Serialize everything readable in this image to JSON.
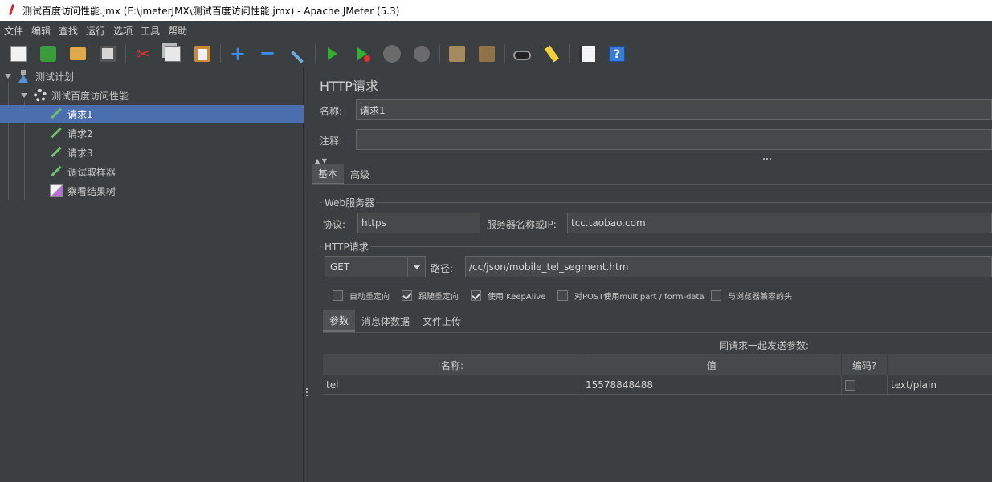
{
  "window": {
    "title": "测试百度访问性能.jmx (E:\\jmeterJMX\\测试百度访问性能.jmx) - Apache JMeter (5.3)"
  },
  "menu": [
    "文件",
    "编辑",
    "查找",
    "运行",
    "选项",
    "工具",
    "帮助"
  ],
  "toolbar": [
    {
      "icon": "new-icon"
    },
    {
      "icon": "templates-icon"
    },
    {
      "icon": "open-icon"
    },
    {
      "icon": "save-icon"
    },
    {
      "icon": "cut-icon"
    },
    {
      "icon": "copy-icon"
    },
    {
      "icon": "paste-icon"
    },
    {
      "icon": "expand-icon"
    },
    {
      "icon": "collapse-icon"
    },
    {
      "icon": "toggle-icon"
    },
    {
      "icon": "start-icon"
    },
    {
      "icon": "start-no-pause-icon"
    },
    {
      "icon": "stop-icon"
    },
    {
      "icon": "shutdown-icon"
    },
    {
      "icon": "clear-icon"
    },
    {
      "icon": "clear-all-icon"
    },
    {
      "icon": "search-icon"
    },
    {
      "icon": "reset-search-icon"
    },
    {
      "icon": "function-helper-icon"
    },
    {
      "icon": "help-icon"
    }
  ],
  "tree": {
    "test_plan": "测试计划",
    "thread_group": "测试百度访问性能",
    "requests": [
      "请求1",
      "请求2",
      "请求3"
    ],
    "debug_sampler": "调试取样器",
    "results_tree": "察看结果树",
    "selected": "请求1"
  },
  "panel": {
    "title": "HTTP请求",
    "name_label": "名称:",
    "name_value": "请求1",
    "comment_label": "注释:",
    "comment_value": "",
    "tabs": [
      "基本",
      "高级"
    ],
    "web_server": {
      "title": "Web服务器",
      "protocol_label": "协议:",
      "protocol_value": "https",
      "server_label": "服务器名称或IP:",
      "server_value": "tcc.taobao.com"
    },
    "http_request": {
      "title": "HTTP请求",
      "method": "GET",
      "path_label": "路径:",
      "path_value": "/cc/json/mobile_tel_segment.htm"
    },
    "options": [
      {
        "label": "自动重定向",
        "checked": false
      },
      {
        "label": "跟随重定向",
        "checked": true
      },
      {
        "label": "使用 KeepAlive",
        "checked": true
      },
      {
        "label": "对POST使用multipart / form-data",
        "checked": false
      },
      {
        "label": "与浏览器兼容的头",
        "checked": false
      }
    ],
    "param_tabs": [
      "参数",
      "消息体数据",
      "文件上传"
    ],
    "params_caption": "同请求一起发送参数:",
    "columns": [
      "名称:",
      "值",
      "编码?",
      ""
    ],
    "rows": [
      {
        "name": "tel",
        "value": "15578848488",
        "encode": false,
        "content_type": "text/plain"
      }
    ]
  }
}
